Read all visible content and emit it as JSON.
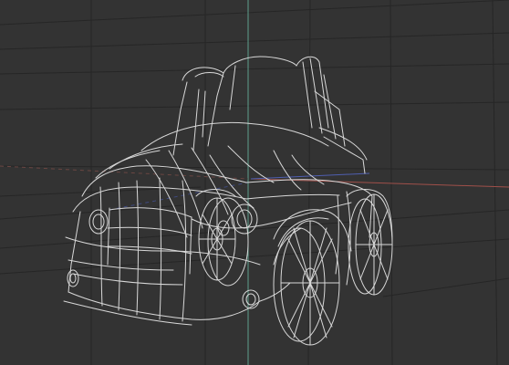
{
  "viewport": {
    "type": "3d-perspective-viewport",
    "display_mode": "wireframe",
    "subject": "cartoon-car-model",
    "colors": {
      "background": "#333333",
      "grid_line": "#262626",
      "wireframe": "#d8d8d8",
      "axis_y": "#5f9f8c",
      "axis_x": "#a0504a",
      "axis_z": "#4f5fb0"
    }
  }
}
